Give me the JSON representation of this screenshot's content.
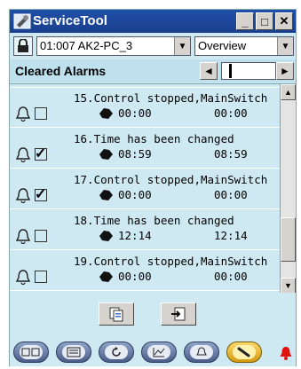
{
  "window": {
    "title": "ServiceTool"
  },
  "titlebar_buttons": {
    "minimize": "_",
    "maximize": "□",
    "close": "✕"
  },
  "controller_select": {
    "value": "01:007 AK2-PC_3"
  },
  "view_select": {
    "value": "Overview"
  },
  "header": {
    "label": "Cleared Alarms",
    "prev": "◄",
    "next": "►"
  },
  "alarms": [
    {
      "text": "15.Control stopped,MainSwitch",
      "time1": "00:00",
      "time2": "00:00",
      "acknowledged": false
    },
    {
      "text": "16.Time has been changed",
      "time1": "08:59",
      "time2": "08:59",
      "acknowledged": true
    },
    {
      "text": "17.Control stopped,MainSwitch",
      "time1": "00:00",
      "time2": "00:00",
      "acknowledged": true
    },
    {
      "text": "18.Time has been changed",
      "time1": "12:14",
      "time2": "12:14",
      "acknowledged": false
    },
    {
      "text": "19.Control stopped,MainSwitch",
      "time1": "00:00",
      "time2": "00:00",
      "acknowledged": false
    }
  ],
  "colors": {
    "accent": "#1f4fa8",
    "background": "#cfe9f3",
    "alarm": "#e01010"
  }
}
